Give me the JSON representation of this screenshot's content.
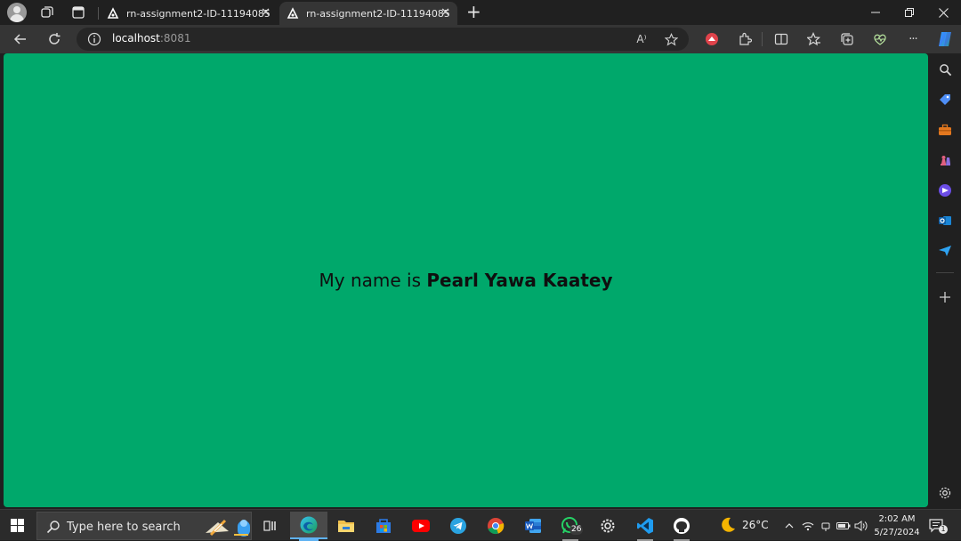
{
  "browser": {
    "tabs": [
      {
        "title": "rn-assignment2-ID-11194085",
        "active": false
      },
      {
        "title": "rn-assignment2-ID-11194085",
        "active": true
      }
    ],
    "new_tab_label": "+",
    "url_host": "localhost",
    "url_port": ":8081",
    "read_aloud_label": "A⁾",
    "more_label": "···"
  },
  "page": {
    "background_color": "#00a86b",
    "greeting_prefix": "My name is ",
    "greeting_name": "Pearl Yawa Kaatey"
  },
  "sidebar": {
    "icons": [
      "search-icon",
      "tag-icon",
      "toolbox-icon",
      "chess-icon",
      "copilot-icon",
      "outlook-icon",
      "send-icon",
      "add-icon",
      "settings-icon"
    ]
  },
  "taskbar": {
    "search_placeholder": "Type here to search",
    "apps": [
      "task-view-icon",
      "edge-icon",
      "file-explorer-icon",
      "store-icon",
      "youtube-icon",
      "telegram-icon",
      "chrome-icon",
      "word-icon",
      "whatsapp-icon",
      "settings-icon",
      "vscode-icon",
      "github-icon"
    ],
    "whatsapp_badge": "26",
    "weather_temp": "26°C",
    "time": "2:02 AM",
    "date": "5/27/2024",
    "notification_count": "1"
  }
}
